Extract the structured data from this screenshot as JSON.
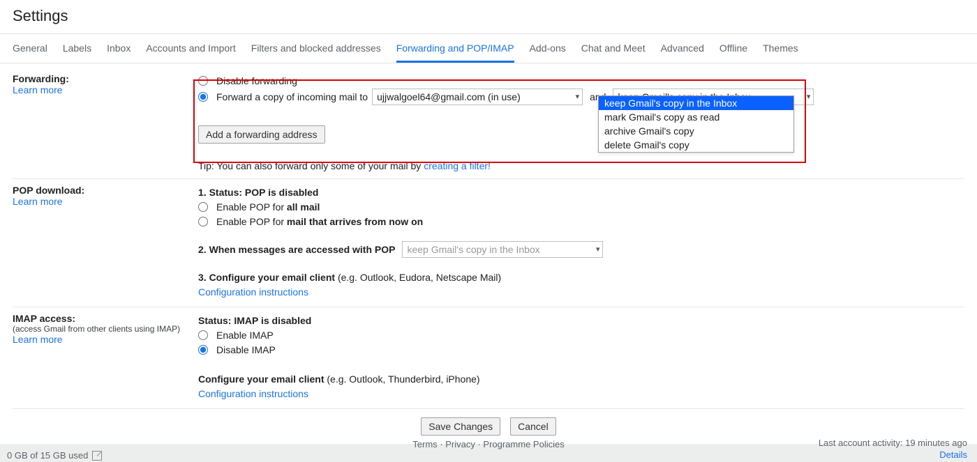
{
  "title": "Settings",
  "tabs": [
    "General",
    "Labels",
    "Inbox",
    "Accounts and Import",
    "Filters and blocked addresses",
    "Forwarding and POP/IMAP",
    "Add-ons",
    "Chat and Meet",
    "Advanced",
    "Offline",
    "Themes"
  ],
  "active_tab_index": 5,
  "forwarding": {
    "heading": "Forwarding:",
    "learn_more": "Learn more",
    "disable_label": "Disable forwarding",
    "forward_label_pre": "Forward a copy of incoming mail to",
    "address_select": "ujjwalgoel64@gmail.com (in use)",
    "and": "and",
    "action_select": "keep Gmail's copy in the Inbox",
    "add_button": "Add a forwarding address",
    "tip_pre": "Tip: You can also forward only some of your mail by ",
    "tip_link": "creating a filter!",
    "dropdown_options": [
      "keep Gmail's copy in the Inbox",
      "mark Gmail's copy as read",
      "archive Gmail's copy",
      "delete Gmail's copy"
    ],
    "dropdown_selected_index": 0
  },
  "pop": {
    "heading": "POP download:",
    "learn_more": "Learn more",
    "status_pre": "1. Status: ",
    "status_bold": "POP is disabled",
    "enable_all_pre": "Enable POP for ",
    "enable_all_bold": "all mail",
    "enable_now_pre": "Enable POP for ",
    "enable_now_bold": "mail that arrives from now on",
    "when_accessed": "2. When messages are accessed with POP",
    "when_select": "keep Gmail's copy in the Inbox",
    "configure_pre": "3. Configure your email client ",
    "configure_eg": "(e.g. Outlook, Eudora, Netscape Mail)",
    "config_link": "Configuration instructions"
  },
  "imap": {
    "heading": "IMAP access:",
    "sub": "(access Gmail from other clients using IMAP)",
    "learn_more": "Learn more",
    "status_pre": "Status: ",
    "status_bold": "IMAP is disabled",
    "enable": "Enable IMAP",
    "disable": "Disable IMAP",
    "configure_pre": "Configure your email client ",
    "configure_eg": "(e.g. Outlook, Thunderbird, iPhone)",
    "config_link": "Configuration instructions"
  },
  "actions": {
    "save": "Save Changes",
    "cancel": "Cancel"
  },
  "footer": {
    "storage": "0 GB of 15 GB used",
    "center": "Terms · Privacy · Programme Policies",
    "activity": "Last account activity: 19 minutes ago",
    "details": "Details"
  }
}
